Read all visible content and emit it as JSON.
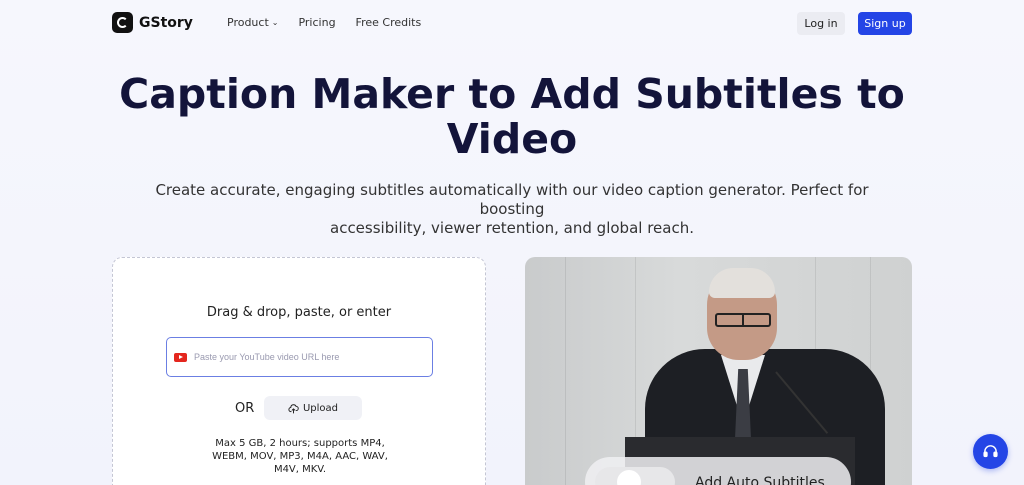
{
  "nav": {
    "brand": "GStory",
    "links": [
      {
        "label": "Product",
        "has_dropdown": true
      },
      {
        "label": "Pricing",
        "has_dropdown": false
      },
      {
        "label": "Free Credits",
        "has_dropdown": false
      }
    ],
    "login_label": "Log in",
    "signup_label": "Sign up"
  },
  "hero": {
    "title_line1": "Caption Maker to Add Subtitles to",
    "title_line2": "Video",
    "subtitle_line1": "Create accurate, engaging subtitles automatically with our video caption generator. Perfect for boosting",
    "subtitle_line2": "accessibility, viewer retention, and global reach."
  },
  "upload": {
    "drag_text": "Drag & drop, paste, or enter",
    "url_placeholder": "Paste your YouTube video URL here",
    "or_text": "OR",
    "upload_label": "Upload",
    "limits_line1": "Max 5 GB, 2 hours; supports MP4,",
    "limits_line2": "WEBM, MOV, MP3, M4A, AAC, WAV,",
    "limits_line3": "M4V, MKV."
  },
  "preview": {
    "overlay_label": "Add Auto Subtitles"
  },
  "colors": {
    "accent": "#2445e6",
    "title": "#13143a",
    "youtube_red": "#e4261e"
  },
  "icons": [
    "gstory-logo-icon",
    "chevron-down-icon",
    "youtube-icon",
    "cloud-upload-icon",
    "headset-icon"
  ]
}
